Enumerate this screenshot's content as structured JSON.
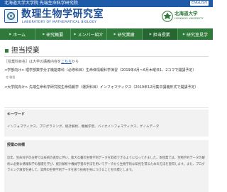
{
  "topbar": {
    "university_lab": "北海道大学大学院 先端生命科学研究院",
    "english_button": "ENGLISH"
  },
  "header": {
    "lab_title": "数理生物学研究室",
    "lab_subtitle": "LABORATORY OF MATHEMATICAL BIOLOGY",
    "university_name": "北海道大学",
    "university_english": "HOKKAIDO UNIVERSITY"
  },
  "nav": [
    {
      "label": "ホーム"
    },
    {
      "label": "研究概要"
    },
    {
      "label": "メンバー紹介"
    },
    {
      "label": "研究業績"
    },
    {
      "label": "担当授業"
    },
    {
      "label": "研究室見学"
    }
  ],
  "page": {
    "title": "担当授業",
    "note_text": "［授業科目名］は大学の講義内容を",
    "note_link": "こちら",
    "note_suffix": "から"
  },
  "courses": [
    {
      "name": "<学部向け> 理学部数学分子機能専科（必修科目）生命体情報科学演習（2019年4月〜6月木曜日1、2コマで開講予定）",
      "lecturer": "北 雅悟"
    },
    {
      "name": "<大学院向け> 先端生命科学研究院生命情報学（選択科目）インフォマティクス（2019年12月集中講義形式で開講予定）"
    }
  ],
  "keywords": {
    "heading": "キーワード",
    "text": "インフォマティクス、プログラミング、統計解析、機械学習、バイオインフォマティクス、ゲノムデータ"
  },
  "objectives": {
    "heading": "授業の目標",
    "text": "近年、生命科学の分野では技術の進歩に伴い、膨大な量の生物学的データを取得できるようになってきました。本授業では、生物学的データの解析に必要な情報科学の基礎を学び、統計解析や機械学習の手法を用いてデータから生物学的な知見を得るための方法を習得します。また、プログラミング演習を通して、実際の生物学的データを扱う技術を身につけることを目標とします。"
  }
}
